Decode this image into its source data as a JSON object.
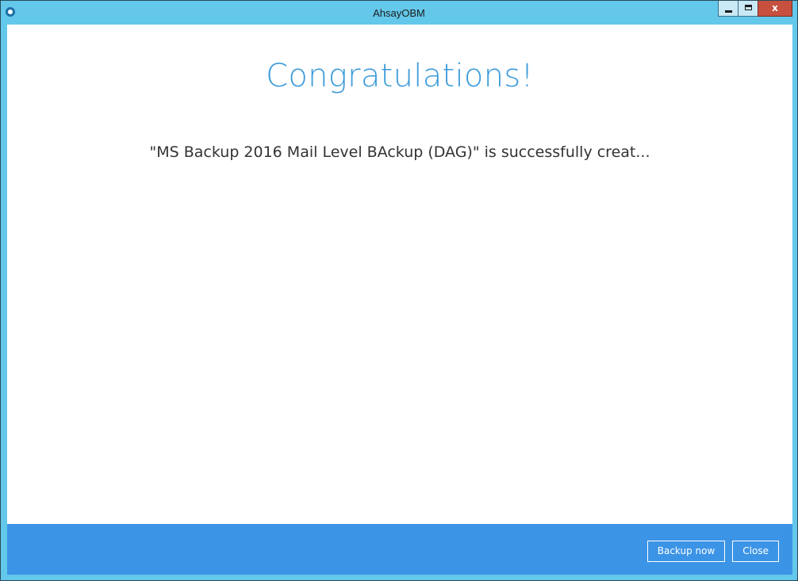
{
  "window": {
    "title": "AhsayOBM",
    "close_glyph": "x",
    "icons": {
      "app": "app-logo-icon",
      "minimize": "minimize-icon",
      "maximize": "maximize-icon",
      "close": "close-icon"
    }
  },
  "main": {
    "heading": "Congratulations!",
    "message": "\"MS Backup 2016 Mail Level BAckup (DAG)\" is successfully creat..."
  },
  "footer": {
    "backup_now_label": "Backup now",
    "close_label": "Close"
  },
  "colors": {
    "titlebar": "#64c8ea",
    "heading": "#3c9bd9",
    "footer": "#3c94e6",
    "close_button": "#c7503f"
  }
}
